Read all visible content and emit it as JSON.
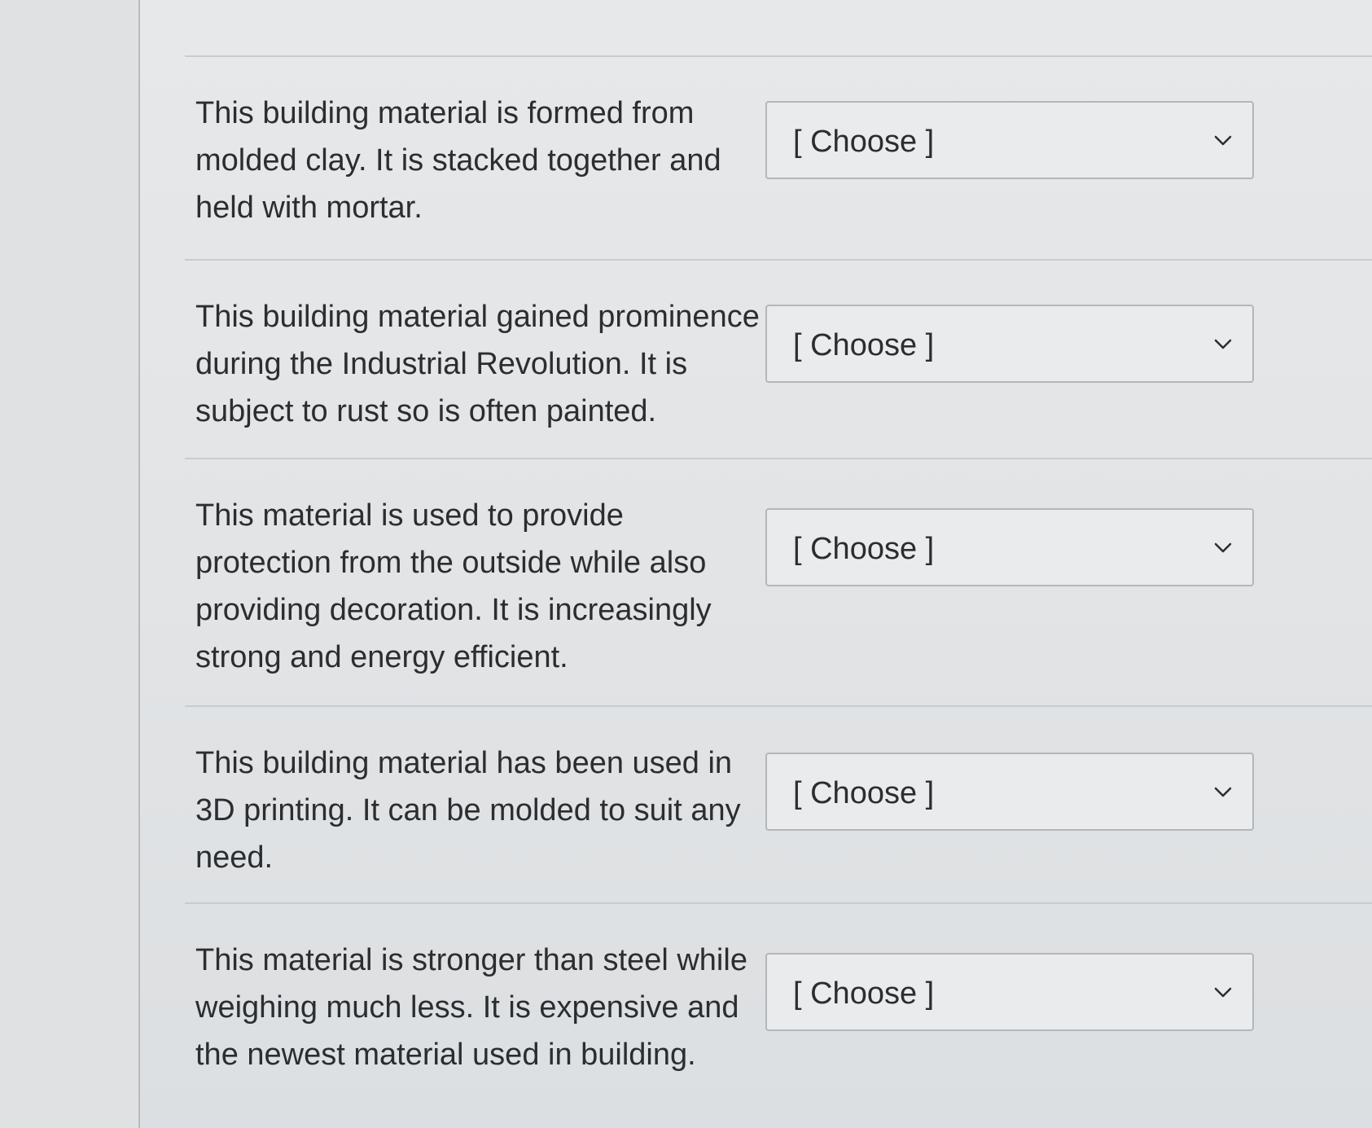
{
  "questions": [
    {
      "prompt": "This building material is formed from molded clay. It is stacked together and held with mortar.",
      "selected": "[ Choose ]"
    },
    {
      "prompt": "This building material gained prominence during the Industrial Revolution. It is subject to rust so is often painted.",
      "selected": "[ Choose ]"
    },
    {
      "prompt": "This material is used to provide protection from the outside while also providing decoration. It is increasingly strong and energy efficient.",
      "selected": "[ Choose ]"
    },
    {
      "prompt": "This building material has been used in 3D printing. It can be molded to suit any need.",
      "selected": "[ Choose ]"
    },
    {
      "prompt": "This material is stronger than steel while weighing much less. It is expensive and the newest material used in building.",
      "selected": "[ Choose ]"
    }
  ],
  "icons": {
    "dropdown": "chevron-down-icon"
  },
  "colors": {
    "text": "#2b2e31",
    "select_border": "#b3b7ba",
    "background": "#e3e5e7"
  }
}
